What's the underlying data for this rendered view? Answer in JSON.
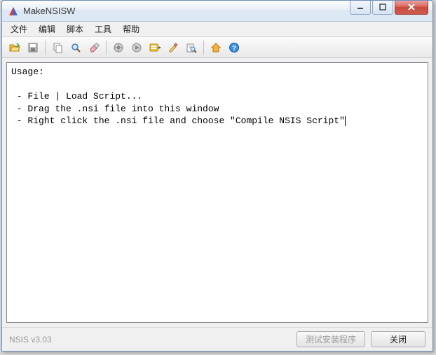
{
  "window": {
    "title": "MakeNSISW"
  },
  "menu": {
    "items": [
      "文件",
      "编辑",
      "脚本",
      "工具",
      "帮助"
    ]
  },
  "toolbar": {
    "icons": [
      "open-folder-icon",
      "save-icon",
      "|",
      "copy-icon",
      "find-icon",
      "clear-icon",
      "|",
      "recompile-icon",
      "run-icon",
      "define-symbols-icon",
      "edit-script-icon",
      "browse-script-icon",
      "|",
      "home-icon",
      "help-icon"
    ]
  },
  "log": {
    "lines": [
      "Usage:",
      "",
      " - File | Load Script...",
      " - Drag the .nsi file into this window",
      " - Right click the .nsi file and choose \"Compile NSIS Script\""
    ]
  },
  "status": {
    "version": "NSIS v3.03",
    "test_button": "测试安装程序",
    "close_button": "关闭"
  }
}
